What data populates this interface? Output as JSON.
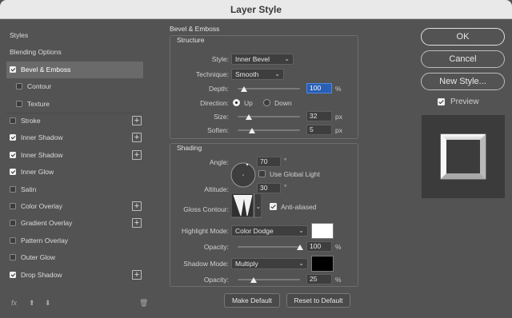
{
  "window": {
    "title": "Layer Style"
  },
  "left_panel": {
    "items": [
      {
        "label": "Styles",
        "checkbox": false,
        "checked": false,
        "indent": false,
        "plus": false,
        "selected": false
      },
      {
        "label": "Blending Options",
        "checkbox": false,
        "checked": false,
        "indent": false,
        "plus": false,
        "selected": false
      },
      {
        "label": "Bevel & Emboss",
        "checkbox": true,
        "checked": true,
        "indent": false,
        "plus": false,
        "selected": true
      },
      {
        "label": "Contour",
        "checkbox": true,
        "checked": false,
        "indent": true,
        "plus": false,
        "selected": false
      },
      {
        "label": "Texture",
        "checkbox": true,
        "checked": false,
        "indent": true,
        "plus": false,
        "selected": false
      },
      {
        "label": "Stroke",
        "checkbox": true,
        "checked": false,
        "indent": false,
        "plus": true,
        "selected": false
      },
      {
        "label": "Inner Shadow",
        "checkbox": true,
        "checked": true,
        "indent": false,
        "plus": true,
        "selected": false
      },
      {
        "label": "Inner Shadow",
        "checkbox": true,
        "checked": true,
        "indent": false,
        "plus": true,
        "selected": false
      },
      {
        "label": "Inner Glow",
        "checkbox": true,
        "checked": true,
        "indent": false,
        "plus": false,
        "selected": false
      },
      {
        "label": "Satin",
        "checkbox": true,
        "checked": false,
        "indent": false,
        "plus": false,
        "selected": false
      },
      {
        "label": "Color Overlay",
        "checkbox": true,
        "checked": false,
        "indent": false,
        "plus": true,
        "selected": false
      },
      {
        "label": "Gradient Overlay",
        "checkbox": true,
        "checked": false,
        "indent": false,
        "plus": true,
        "selected": false
      },
      {
        "label": "Pattern Overlay",
        "checkbox": true,
        "checked": false,
        "indent": false,
        "plus": false,
        "selected": false
      },
      {
        "label": "Outer Glow",
        "checkbox": true,
        "checked": false,
        "indent": false,
        "plus": false,
        "selected": false
      },
      {
        "label": "Drop Shadow",
        "checkbox": true,
        "checked": true,
        "indent": false,
        "plus": true,
        "selected": false
      }
    ],
    "footer": {
      "fx": "fx"
    }
  },
  "bevel": {
    "section_title": "Bevel & Emboss",
    "structure_title": "Structure",
    "style_label": "Style:",
    "style_value": "Inner Bevel",
    "technique_label": "Technique:",
    "technique_value": "Smooth",
    "depth_label": "Depth:",
    "depth_value": "100",
    "depth_unit": "%",
    "direction_label": "Direction:",
    "direction_up": "Up",
    "direction_down": "Down",
    "direction_selected": "Up",
    "size_label": "Size:",
    "size_value": "32",
    "size_unit": "px",
    "soften_label": "Soften:",
    "soften_value": "5",
    "soften_unit": "px"
  },
  "shading": {
    "title": "Shading",
    "angle_label": "Angle:",
    "angle_value": "70",
    "degree": "°",
    "global_light_label": "Use Global Light",
    "global_light_checked": false,
    "altitude_label": "Altitude:",
    "altitude_value": "30",
    "gloss_label": "Gloss Contour:",
    "anti_aliased_label": "Anti-aliased",
    "anti_aliased_checked": true,
    "highlight_mode_label": "Highlight Mode:",
    "highlight_mode_value": "Color Dodge",
    "highlight_color": "#ffffff",
    "highlight_opacity_label": "Opacity:",
    "highlight_opacity_value": "100",
    "shadow_mode_label": "Shadow Mode:",
    "shadow_mode_value": "Multiply",
    "shadow_color": "#000000",
    "shadow_opacity_label": "Opacity:",
    "shadow_opacity_value": "25",
    "pct": "%"
  },
  "buttons": {
    "make_default": "Make Default",
    "reset_default": "Reset to Default",
    "ok": "OK",
    "cancel": "Cancel",
    "new_style": "New Style...",
    "preview_label": "Preview",
    "preview_checked": true
  },
  "sliders": {
    "depth": 0.1,
    "size": 0.18,
    "soften": 0.23,
    "highlight_opacity": 1.0,
    "shadow_opacity": 0.25
  },
  "colors": {
    "accent": "#2a5fb4"
  }
}
